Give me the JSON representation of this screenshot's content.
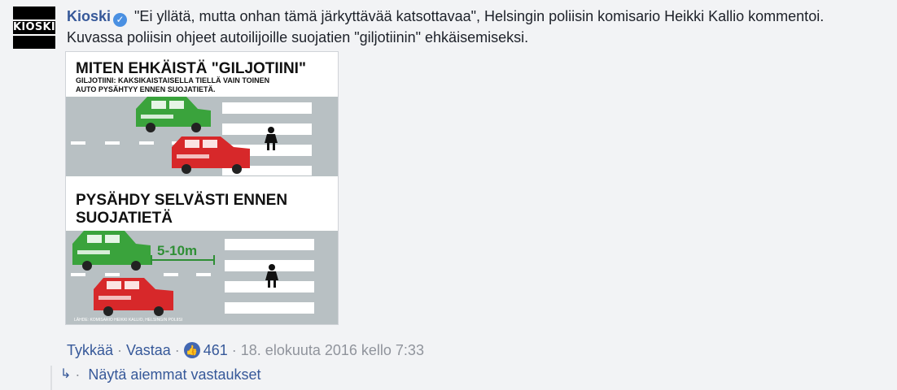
{
  "avatar": {
    "label": "KIOSKI"
  },
  "comment": {
    "author": "Kioski",
    "text": "\"Ei yllätä, mutta onhan tämä järkyttävää katsottavaa\", Helsingin poliisin komisario Heikki Kallio kommentoi. Kuvassa poliisin ohjeet autoilijoille suojatien \"giljotiinin\" ehkäisemiseksi."
  },
  "image": {
    "heading": "MITEN EHKÄISTÄ \"GILJOTIINI\"",
    "subline1": "GILJOTIINI: KAKSIKAISTAISELLA TIELLÄ VAIN TOINEN",
    "subline2": "AUTO PYSÄHTYY ENNEN SUOJATIETÄ.",
    "heading2_line1": "PYSÄHDY SELVÄSTI ENNEN",
    "heading2_line2": "SUOJATIETÄ",
    "distance": "5-10m",
    "source": "LÄHDE: KOMISARIO HEIKKI KALLIO, HELSINGIN POLIISI",
    "colors": {
      "green_car": "#3aa33c",
      "red_car": "#d7282a",
      "road": "#b8c0c3"
    }
  },
  "actions": {
    "like": "Tykkää",
    "reply": "Vastaa",
    "like_count": "461",
    "timestamp": "18. elokuuta 2016 kello 7:33"
  },
  "replies": {
    "label": "Näytä aiemmat vastaukset"
  }
}
